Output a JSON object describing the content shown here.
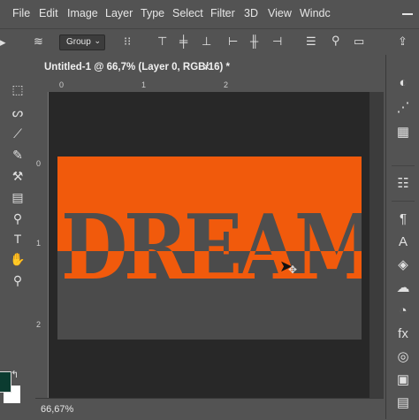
{
  "menu": {
    "items": [
      "File",
      "Edit",
      "Image",
      "Layer",
      "Type",
      "Select",
      "Filter",
      "3D",
      "View",
      "Windc"
    ]
  },
  "options_bar": {
    "auto_select_value": "Group",
    "icons": [
      "move-arrow-icon",
      "layers-stack-icon",
      "transform-controls-icon",
      "align-top-icon",
      "align-vcenter-icon",
      "align-bottom-icon",
      "align-left-icon",
      "align-hcenter-icon",
      "align-right-icon",
      "distribute-icon",
      "search-icon",
      "workspace-icon",
      "share-icon"
    ]
  },
  "document": {
    "tab_title": "Untitled-1 @ 66,7% (Layer 0, RGB/16) *",
    "close_glyph": "×",
    "canvas_text_top": "DREAM",
    "canvas_text_bottom": "DREAM",
    "colors": {
      "orange": "#f15a0c",
      "canvas_gray": "#4b4b4b",
      "workspace": "#282828"
    }
  },
  "rulers": {
    "top": [
      "0",
      "1",
      "2"
    ],
    "left": [
      "0",
      "1",
      "2"
    ]
  },
  "tools": {
    "foreground_color": "#0b3b30",
    "background_color": "#ffffff"
  },
  "status": {
    "zoom": "66,67%"
  }
}
